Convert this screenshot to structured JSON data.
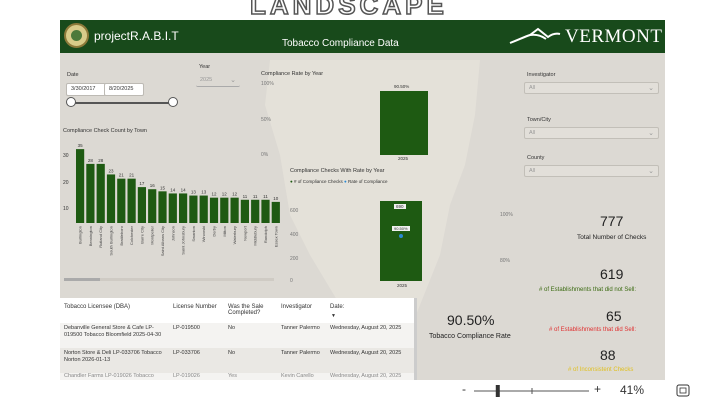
{
  "top_logo_partial": "LANDSCAPE",
  "header": {
    "brand": "projectR.A.B.I.T",
    "report_title": "Tobacco Compliance Data",
    "state_logo": "VERMONT"
  },
  "filters": {
    "date_label": "Date",
    "date_start": "3/30/2017",
    "date_end": "8/20/2025",
    "year_label": "Year",
    "year_value": "2025",
    "investigator_label": "Investigator",
    "investigator_value": "All",
    "town_label": "Town/City",
    "town_value": "All",
    "county_label": "County",
    "county_value": "All"
  },
  "compliance_rate_chart": {
    "title": "Compliance Rate by Year",
    "bar_label": "90.50%",
    "x_label": "2025",
    "ticks": [
      "100%",
      "50%",
      "0%"
    ],
    "bar_color": "#1e5a12"
  },
  "count_chart": {
    "title": "Compliance Check Count by Town",
    "ticks": [
      "30",
      "20",
      "10",
      "0"
    ]
  },
  "rate_chart": {
    "title": "Compliance Checks With Rate by Year",
    "legend_checks": "# of Compliance Checks",
    "legend_rate": "Rate of Compliance",
    "label_checks": "690",
    "label_rate": "90.50%",
    "x_label": "2025",
    "left_ticks": [
      "600",
      "400",
      "200",
      "0"
    ],
    "right_ticks": [
      "100%",
      "80%"
    ],
    "dot_checks_color": "#1e5a12",
    "dot_rate_color": "#2a8ad4"
  },
  "chart_data": [
    {
      "type": "bar",
      "title": "Compliance Check Count by Town",
      "categories": [
        "Burlington",
        "Bennington",
        "Rutland City",
        "South Burlington",
        "Brattleboro",
        "Colchester",
        "Barre City",
        "Montpelier",
        "Saint Albans City",
        "Johnson",
        "Saint Johnsbury",
        "Swanton",
        "Winooski",
        "Derby",
        "Milton",
        "Waterbury",
        "Newport",
        "Middlebury",
        "Randolph",
        "Essex Town"
      ],
      "values": [
        35,
        28,
        28,
        23,
        21,
        21,
        17,
        16,
        15,
        14,
        14,
        13,
        13,
        12,
        12,
        12,
        11,
        11,
        11,
        10
      ],
      "ylim": [
        0,
        36
      ],
      "color": "#1e5a12"
    },
    {
      "type": "bar",
      "title": "Compliance Rate by Year",
      "categories": [
        "2025"
      ],
      "values": [
        90.5
      ],
      "ylim": [
        0,
        100
      ],
      "color": "#1e5a12"
    },
    {
      "type": "bar",
      "title": "Compliance Checks With Rate by Year",
      "categories": [
        "2025"
      ],
      "series": [
        {
          "name": "# of Compliance Checks",
          "values": [
            690
          ]
        },
        {
          "name": "Rate of Compliance",
          "values": [
            90.5
          ]
        }
      ],
      "ylim": [
        0,
        700
      ]
    }
  ],
  "kpis": {
    "total_checks": "777",
    "total_checks_label": "Total Number of Checks",
    "did_not_sell": "619",
    "did_not_sell_label": "# of Establishments that did not Sell:",
    "did_sell": "65",
    "did_sell_label": "# of Establishments that did Sell:",
    "inconsistent": "88",
    "inconsistent_label": "# of Inconsistent Checks",
    "compliance_rate": "90.50%",
    "compliance_rate_label": "Tobacco Compliance Rate",
    "color_green": "#3a6a10",
    "color_red": "#e03030",
    "color_yellow": "#e0c020"
  },
  "table": {
    "headers": [
      "Tobacco Licensee (DBA)",
      "License Number",
      "Was the Sale Completed?",
      "Investigator",
      "Date:"
    ],
    "rows": [
      {
        "licensee": "Debanville General Store & Cafe LP-019500 Tobacco Bloomfield 2025-04-30",
        "license": "LP-019500",
        "sale": "No",
        "investigator": "Tanner Palermo",
        "date": "Wednesday, August 20, 2025"
      },
      {
        "licensee": "Norton Store & Deli LP-033706 Tobacco Norton 2026-01-13",
        "license": "LP-033706",
        "sale": "No",
        "investigator": "Tanner Palermo",
        "date": "Wednesday, August 20, 2025"
      },
      {
        "licensee": "Chandler Farms LP-019026 Tobacco",
        "license": "LP-019026",
        "sale": "Yes",
        "investigator": "Kevin Carello",
        "date": "Wednesday, August 20, 2025"
      }
    ]
  },
  "zoom": {
    "minus": "-",
    "plus": "+",
    "level": "41%",
    "level_fraction": 0.41
  }
}
